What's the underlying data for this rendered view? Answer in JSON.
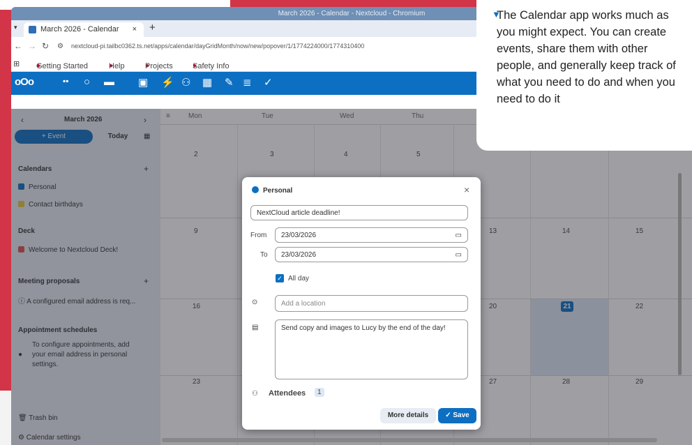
{
  "browser": {
    "window_title": "March 2026 - Calendar - Nextcloud - Chromium",
    "tab_title": "March 2026 - Calendar",
    "tab_close": "×",
    "new_tab": "+",
    "url": "nextcloud-pi.tailbc0362.ts.net/apps/calendar/dayGridMonth/now/new/popover/1/1774224000/1774310400",
    "bookmarks": [
      "Getting Started",
      "Help",
      "Projects",
      "Safety Info"
    ]
  },
  "sidebar": {
    "month": "March 2026",
    "new_event": "+ Event",
    "today": "Today",
    "calendars_title": "Calendars",
    "calendars": [
      "Personal",
      "Contact birthdays"
    ],
    "deck_title": "Deck",
    "deck_items": [
      "Welcome to Nextcloud Deck!"
    ],
    "meeting_title": "Meeting proposals",
    "meeting_note": "A configured email address is req...",
    "appointments_title": "Appointment schedules",
    "appointments_note_1": "To configure appointments, add",
    "appointments_note_2": "your email address in personal",
    "appointments_note_3": "settings.",
    "trash": "Trash bin",
    "settings": "Calendar settings",
    "colors": {
      "personal": "#0d6fc2",
      "birthdays": "#e8c63a",
      "deck": "#d9534f"
    }
  },
  "calendar": {
    "weekdays": [
      "Mon",
      "Tue",
      "Wed",
      "Thu"
    ],
    "rows": [
      [
        "2",
        "3",
        "4",
        "5",
        "",
        "",
        ""
      ],
      [
        "9",
        "",
        "",
        "",
        "13",
        "14",
        "15"
      ],
      [
        "16",
        "",
        "",
        "",
        "20",
        "21",
        "22"
      ],
      [
        "23",
        "",
        "",
        "",
        "27",
        "28",
        "29"
      ]
    ],
    "today": "21"
  },
  "popover": {
    "calendar_name": "Personal",
    "close": "×",
    "title_value": "NextCloud article deadline!",
    "from_label": "From",
    "from_value": "23/03/2026",
    "to_label": "To",
    "to_value": "23/03/2026",
    "all_day_label": "All day",
    "location_placeholder": "Add a location",
    "description_value": "Send copy and images to Lucy by the end of the day!",
    "attendees_label": "Attendees",
    "attendees_count": "1",
    "more_details": "More details",
    "save": "✓ Save"
  },
  "caption": {
    "text": "The Calendar app works much as you might expect. You can create events, share them with other people, and generally keep track of what you need to do and when you need to do it"
  }
}
